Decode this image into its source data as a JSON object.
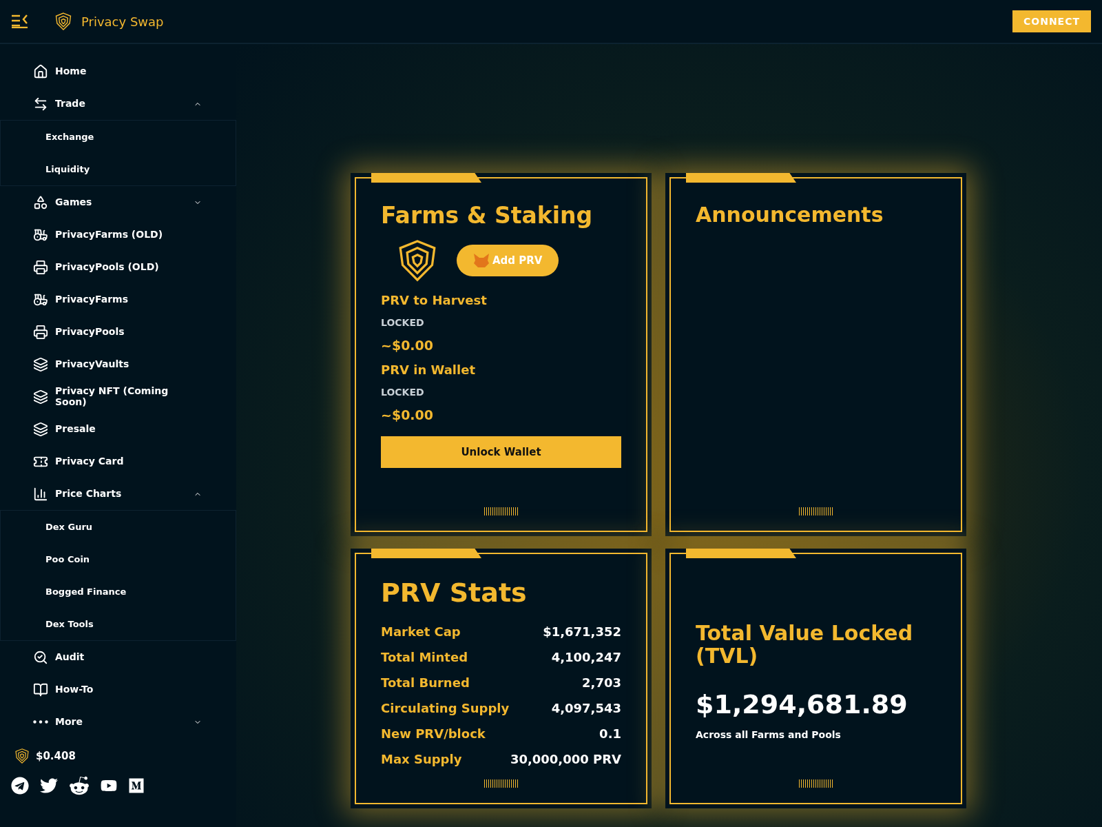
{
  "header": {
    "title": "Privacy Swap",
    "connect_button": "CONNECT"
  },
  "sidebar": {
    "items": [
      {
        "label": "Home"
      },
      {
        "label": "Trade",
        "expanded": true,
        "children": [
          {
            "label": "Exchange"
          },
          {
            "label": "Liquidity"
          }
        ]
      },
      {
        "label": "Games",
        "expanded": false
      },
      {
        "label": "PrivacyFarms (OLD)"
      },
      {
        "label": "PrivacyPools (OLD)"
      },
      {
        "label": "PrivacyFarms"
      },
      {
        "label": "PrivacyPools"
      },
      {
        "label": "PrivacyVaults"
      },
      {
        "label": "Privacy NFT (Coming Soon)"
      },
      {
        "label": "Presale"
      },
      {
        "label": "Privacy Card"
      },
      {
        "label": "Price Charts",
        "expanded": true,
        "children": [
          {
            "label": "Dex Guru"
          },
          {
            "label": "Poo Coin"
          },
          {
            "label": "Bogged Finance"
          },
          {
            "label": "Dex Tools"
          }
        ]
      },
      {
        "label": "Audit"
      },
      {
        "label": "How-To"
      },
      {
        "label": "More",
        "expanded": false
      }
    ],
    "price": "$0.408"
  },
  "farms": {
    "title": "Farms & Staking",
    "add_button": "Add PRV",
    "harvest_label": "PRV to Harvest",
    "harvest_status": "LOCKED",
    "harvest_value": "~$0.00",
    "wallet_label": "PRV in Wallet",
    "wallet_status": "LOCKED",
    "wallet_value": "~$0.00",
    "unlock_button": "Unlock Wallet"
  },
  "announcements": {
    "title": "Announcements"
  },
  "stats": {
    "title": "PRV Stats",
    "rows": [
      {
        "label": "Market Cap",
        "value": "$1,671,352"
      },
      {
        "label": "Total Minted",
        "value": "4,100,247"
      },
      {
        "label": "Total Burned",
        "value": "2,703"
      },
      {
        "label": "Circulating Supply",
        "value": "4,097,543"
      },
      {
        "label": "New PRV/block",
        "value": "0.1"
      },
      {
        "label": "Max Supply",
        "value": "30,000,000 PRV"
      }
    ]
  },
  "tvl": {
    "title": "Total Value Locked (TVL)",
    "value": "$1,294,681.89",
    "caption": "Across all Farms and Pools"
  }
}
